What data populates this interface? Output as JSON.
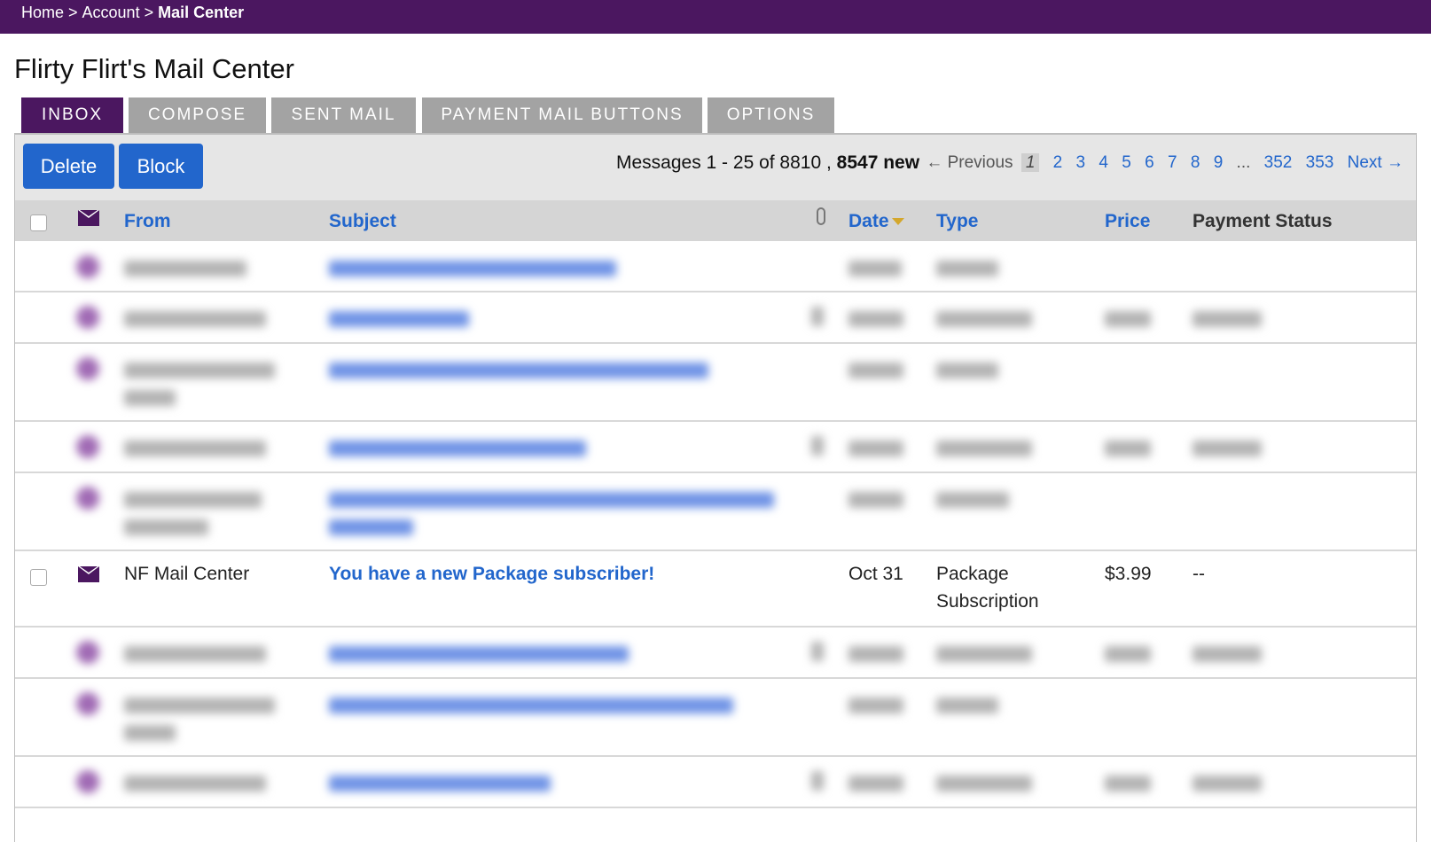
{
  "breadcrumb": {
    "home": "Home",
    "account": "Account",
    "current": "Mail Center",
    "separator": ">"
  },
  "page_title": "Flirty Flirt's Mail Center",
  "tabs": [
    {
      "label": "INBOX",
      "active": true
    },
    {
      "label": "COMPOSE",
      "active": false
    },
    {
      "label": "SENT MAIL",
      "active": false
    },
    {
      "label": "PAYMENT MAIL BUTTONS",
      "active": false
    },
    {
      "label": "OPTIONS",
      "active": false
    }
  ],
  "actions": {
    "delete_label": "Delete",
    "block_label": "Block"
  },
  "summary": {
    "range": "Messages 1 - 25 of 8810 ,",
    "new_count": "8547 new"
  },
  "pagination": {
    "previous": "← Previous",
    "current": "1",
    "pages": [
      "2",
      "3",
      "4",
      "5",
      "6",
      "7",
      "8",
      "9"
    ],
    "ellipsis": "...",
    "last_pages": [
      "352",
      "353"
    ],
    "next": "Next →"
  },
  "table": {
    "headers": {
      "from": "From",
      "subject": "Subject",
      "date": "Date",
      "type": "Type",
      "price": "Price",
      "payment_status": "Payment Status"
    },
    "visible_row": {
      "from": "NF Mail Center",
      "subject": "You have a new Package subscriber!",
      "date": "Oct 31",
      "type_line1": "Package",
      "type_line2": "Subscription",
      "price": "$3.99",
      "payment_status": "--"
    }
  },
  "colors": {
    "brand": "#4b1760",
    "link": "#2266cc",
    "tab_inactive": "#a3a3a3",
    "header_bg": "#d5d5d5"
  },
  "icons": {
    "envelope": "envelope-icon",
    "attachment": "paperclip-icon",
    "sort": "sort-desc-arrow-icon"
  }
}
